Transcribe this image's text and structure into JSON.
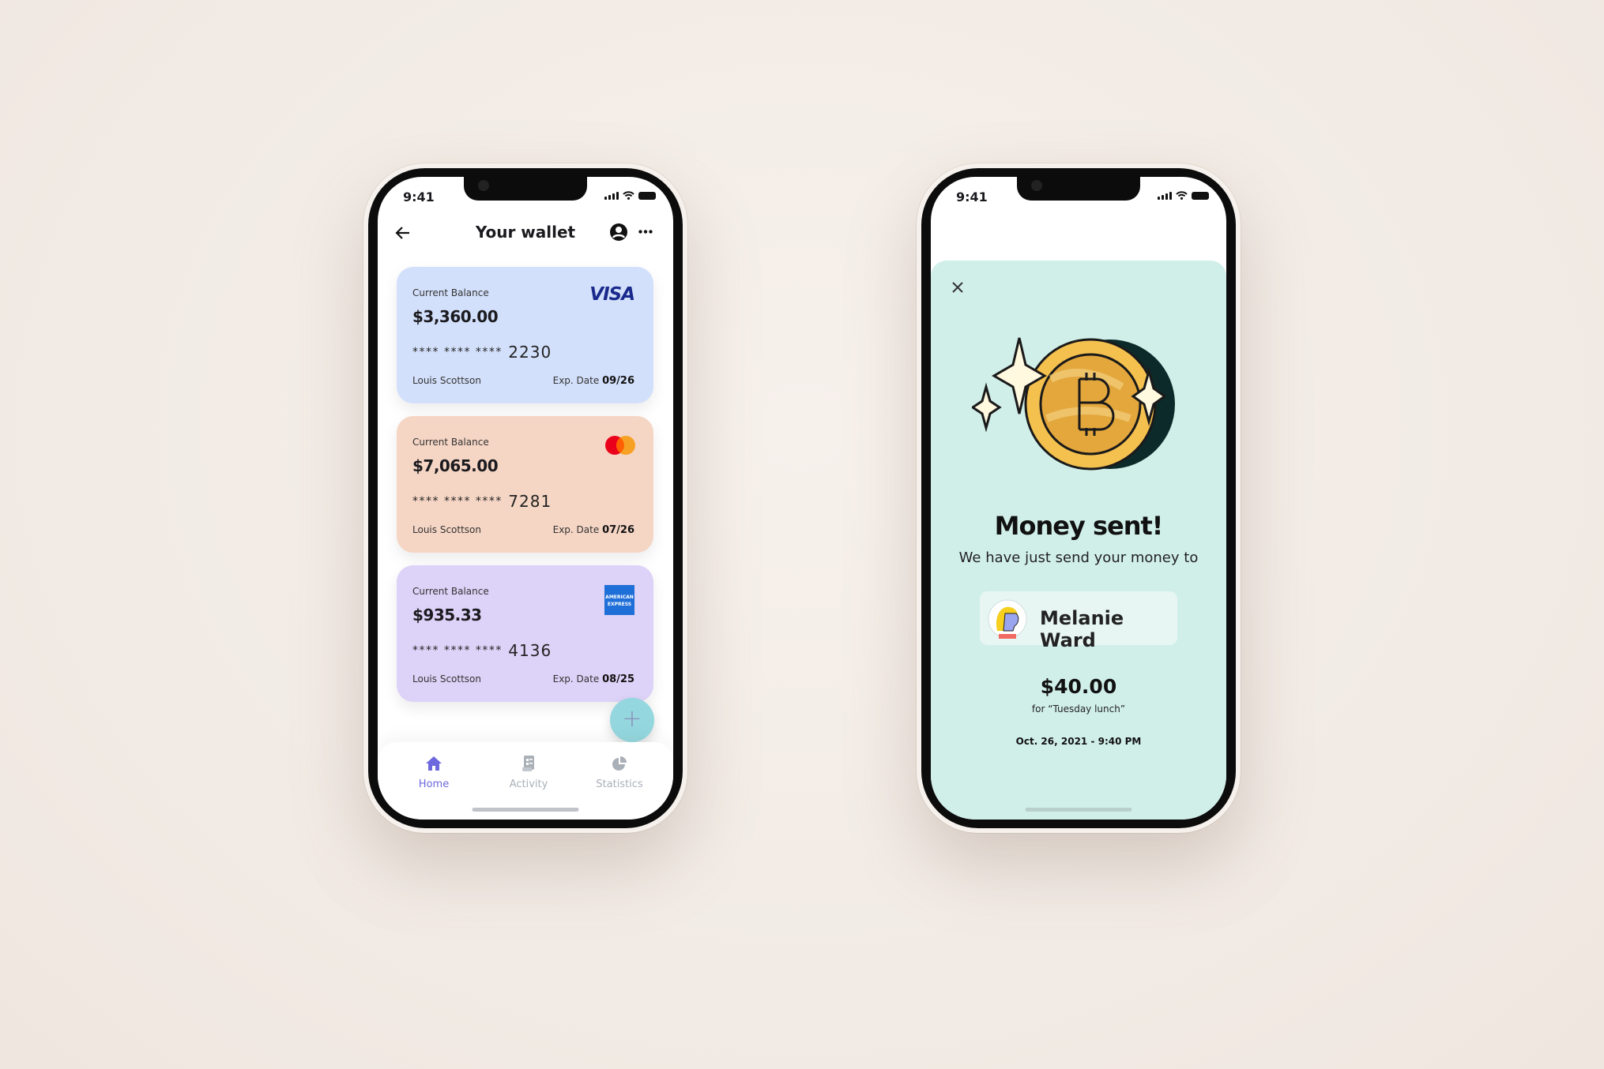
{
  "wallet_screen": {
    "status_time": "9:41",
    "title": "Your wallet",
    "icons": {
      "back": "arrow-left-icon",
      "profile": "user-circle-icon",
      "more": "more-dots-icon"
    },
    "cards": [
      {
        "label": "Current Balance",
        "balance": "$3,360.00",
        "masked": "**** **** ****",
        "last4": "2230",
        "holder": "Louis Scottson",
        "exp_label": "Exp. Date",
        "exp": "09/26",
        "brand": "VISA",
        "color": "#d3e0fb"
      },
      {
        "label": "Current Balance",
        "balance": "$7,065.00",
        "masked": "**** **** ****",
        "last4": "7281",
        "holder": "Louis Scottson",
        "exp_label": "Exp. Date",
        "exp": "07/26",
        "brand": "mastercard",
        "color": "#f5d5c4"
      },
      {
        "label": "Current Balance",
        "balance": "$935.33",
        "masked": "**** **** ****",
        "last4": "4136",
        "holder": "Louis Scottson",
        "exp_label": "Exp. Date",
        "exp": "08/25",
        "brand": "AMERICAN EXPRESS",
        "color": "#ddd2f7"
      }
    ],
    "fab": "+",
    "nav": [
      {
        "label": "Home",
        "icon": "home-icon",
        "active": true
      },
      {
        "label": "Activity",
        "icon": "receipt-icon",
        "active": false
      },
      {
        "label": "Statistics",
        "icon": "pie-chart-icon",
        "active": false
      }
    ],
    "accent": "#6d68de"
  },
  "success_screen": {
    "status_time": "9:41",
    "close_icon": "close-icon",
    "illustration": "bitcoin-coin",
    "title": "Money sent!",
    "subtitle": "We have just send your money to",
    "recipient": "Melanie Ward",
    "amount": "$40.00",
    "note": "for “Tuesday lunch”",
    "datetime": "Oct. 26, 2021 - 9:40 PM",
    "background": "#d1efe9"
  }
}
